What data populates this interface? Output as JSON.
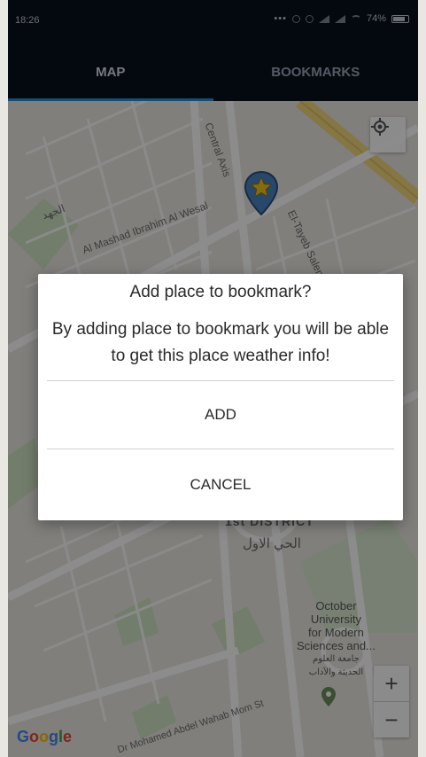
{
  "status_bar": {
    "time": "18:26",
    "battery": "74%"
  },
  "tabs": [
    {
      "label": "MAP",
      "active": true
    },
    {
      "label": "BOOKMARKS",
      "active": false
    }
  ],
  "map": {
    "labels": {
      "street_1": "Al Mashad Ibrahim Al Wesal",
      "street_2": "El-Tayeb Salem",
      "street_3": "Dr Mohamed Abdel Wahab Mom St",
      "street_4": "Central Axis",
      "district_en": "1st DISTRICT",
      "district_ar": "الحي الاول",
      "ar_label": "الجهد",
      "poi_university": [
        "October",
        "University",
        "for Modern",
        "Sciences and..."
      ],
      "poi_university_ar": [
        "جامعة العلوم",
        "الحديثة والآداب"
      ]
    },
    "google_logo": "Google",
    "zoom_in": "+",
    "zoom_out": "−"
  },
  "dialog": {
    "title": "Add place to bookmark?",
    "message": "By adding place to bookmark you will be able to get this place weather info!",
    "add_label": "ADD",
    "cancel_label": "CANCEL"
  },
  "colors": {
    "header_bg": "#08111d",
    "tab_indicator": "#2b8bd6",
    "marker_fill": "#4a83c4",
    "marker_star": "#f3c21a"
  }
}
